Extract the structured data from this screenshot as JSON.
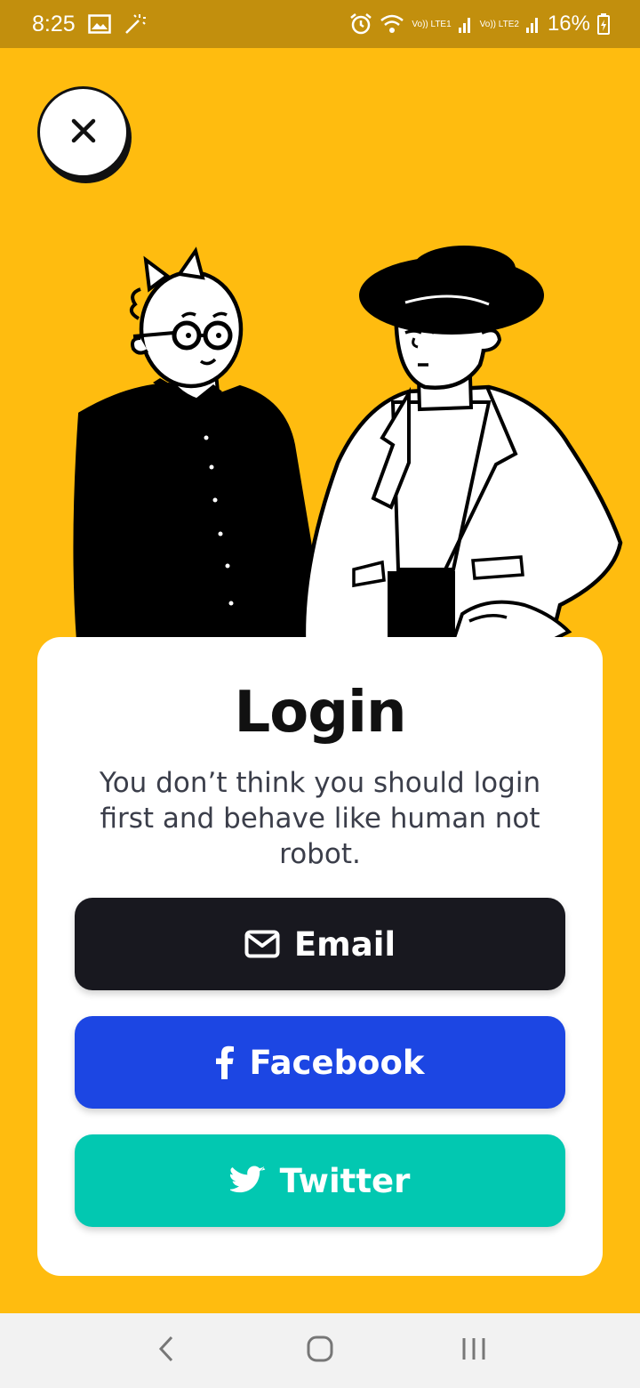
{
  "status_bar": {
    "time": "8:25",
    "lte1": "Vo)) LTE1",
    "lte2": "Vo)) LTE2",
    "battery": "16%"
  },
  "login": {
    "title": "Login",
    "description": "You don’t think you should login first and behave like human not robot."
  },
  "buttons": {
    "email": "Email",
    "facebook": "Facebook",
    "twitter": "Twitter"
  },
  "colors": {
    "background": "#FFBC0F",
    "status_bar": "#C28F0D",
    "email": "#18181F",
    "facebook": "#1C46E3",
    "twitter": "#02C8B1"
  },
  "icons": {
    "close": "close-icon",
    "email": "mail-icon",
    "facebook": "facebook-icon",
    "twitter": "twitter-icon"
  }
}
